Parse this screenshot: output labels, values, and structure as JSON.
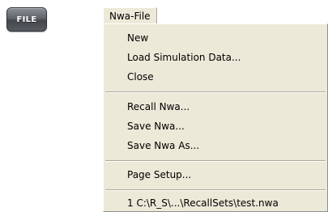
{
  "file_key": {
    "label": "FILE",
    "icon": "hard-key-button"
  },
  "menu": {
    "title": "Nwa-File",
    "items": [
      {
        "label": "New"
      },
      {
        "label": "Load Simulation Data..."
      },
      {
        "label": "Close"
      },
      {
        "label": "Recall Nwa..."
      },
      {
        "label": "Save Nwa..."
      },
      {
        "label": "Save Nwa As..."
      },
      {
        "label": "Page Setup..."
      },
      {
        "label": "1 C:\\R_S\\...\\RecallSets\\test.nwa"
      }
    ]
  },
  "colors": {
    "menu_background": "#ece9d8",
    "separator": "#aca899",
    "key_dark": "#43474c",
    "key_light": "#8b9096"
  }
}
